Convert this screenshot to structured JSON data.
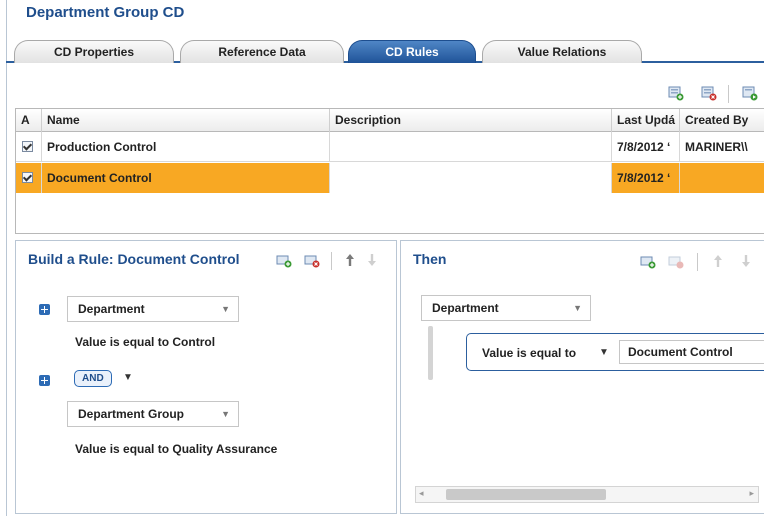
{
  "header": {
    "title": "Department Group CD"
  },
  "tabs": [
    {
      "label": "CD Properties",
      "active": false
    },
    {
      "label": "Reference Data",
      "active": false
    },
    {
      "label": "CD Rules",
      "active": true
    },
    {
      "label": "Value Relations",
      "active": false
    }
  ],
  "toolbar": {
    "icons": [
      "add-rule-icon",
      "delete-rule-icon",
      "run-rule-icon"
    ]
  },
  "grid": {
    "columns": [
      "A",
      "Name",
      "Description",
      "Last Updá",
      "Created By"
    ],
    "rows": [
      {
        "active": true,
        "name": "Production Control",
        "description": "",
        "last_updated": "7/8/2012 ‘",
        "created_by": "MARINER\\\\",
        "selected": false
      },
      {
        "active": true,
        "name": "Document Control",
        "description": "",
        "last_updated": "7/8/2012 ‘",
        "created_by": "",
        "selected": true
      }
    ]
  },
  "build_rule": {
    "title": "Build a Rule: Document Control",
    "condition1": {
      "field": "Department",
      "text": "Value is equal to  Control"
    },
    "operator": "AND",
    "condition2": {
      "field": "Department Group",
      "text": "Value is equal to  Quality Assurance"
    }
  },
  "then_panel": {
    "title": "Then",
    "field": "Department",
    "operator_label": "Value is equal to",
    "value": "Document Control"
  },
  "colors": {
    "accent": "#1f4e8c",
    "tab_active": "#2c5f9e",
    "selected_row": "#f8a823"
  }
}
